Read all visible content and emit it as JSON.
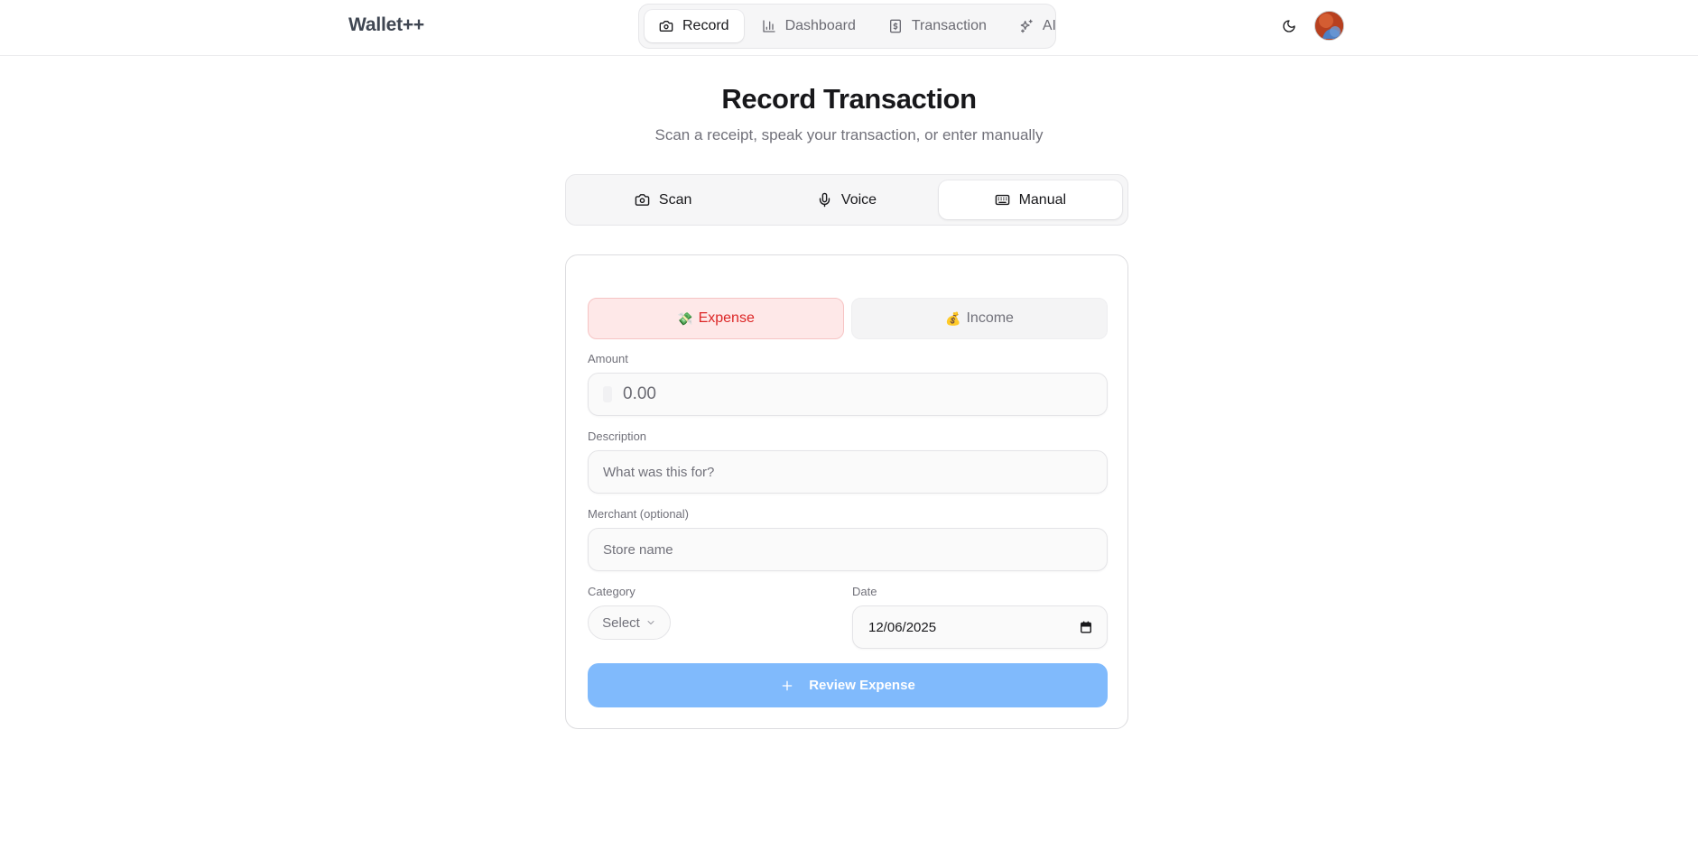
{
  "app": {
    "brand": "Wallet++"
  },
  "nav": {
    "items": [
      {
        "label": "Record",
        "icon": "camera-icon",
        "active": true
      },
      {
        "label": "Dashboard",
        "icon": "bar-chart-icon",
        "active": false
      },
      {
        "label": "Transaction",
        "icon": "dollar-receipt-icon",
        "active": false
      },
      {
        "label": "AI",
        "icon": "sparkles-icon",
        "active": false
      }
    ]
  },
  "header": {
    "theme_icon": "moon-icon",
    "avatar_icon": "avatar"
  },
  "page": {
    "title": "Record Transaction",
    "subtitle": "Scan a receipt, speak your transaction, or enter manually"
  },
  "modes": {
    "items": [
      {
        "label": "Scan",
        "icon": "camera-icon",
        "active": false
      },
      {
        "label": "Voice",
        "icon": "microphone-icon",
        "active": false
      },
      {
        "label": "Manual",
        "icon": "keyboard-icon",
        "active": true
      }
    ]
  },
  "form": {
    "type": {
      "expense_emoji": "💸",
      "expense_label": "Expense",
      "income_emoji": "💰",
      "income_label": "Income",
      "selected": "Expense"
    },
    "amount": {
      "label": "Amount",
      "placeholder": "0.00",
      "value": ""
    },
    "description": {
      "label": "Description",
      "placeholder": "What was this for?",
      "value": ""
    },
    "merchant": {
      "label": "Merchant (optional)",
      "placeholder": "Store name",
      "value": ""
    },
    "category": {
      "label": "Category",
      "value": "Select"
    },
    "date": {
      "label": "Date",
      "value": "12/06/2025"
    },
    "submit_label": "Review Expense",
    "submit_icon": "plus-icon"
  },
  "colors": {
    "expense_bg": "#fee8e8",
    "expense_text": "#dc2626",
    "submit_bg": "#80bafc",
    "brand_text": "#3f4652"
  }
}
